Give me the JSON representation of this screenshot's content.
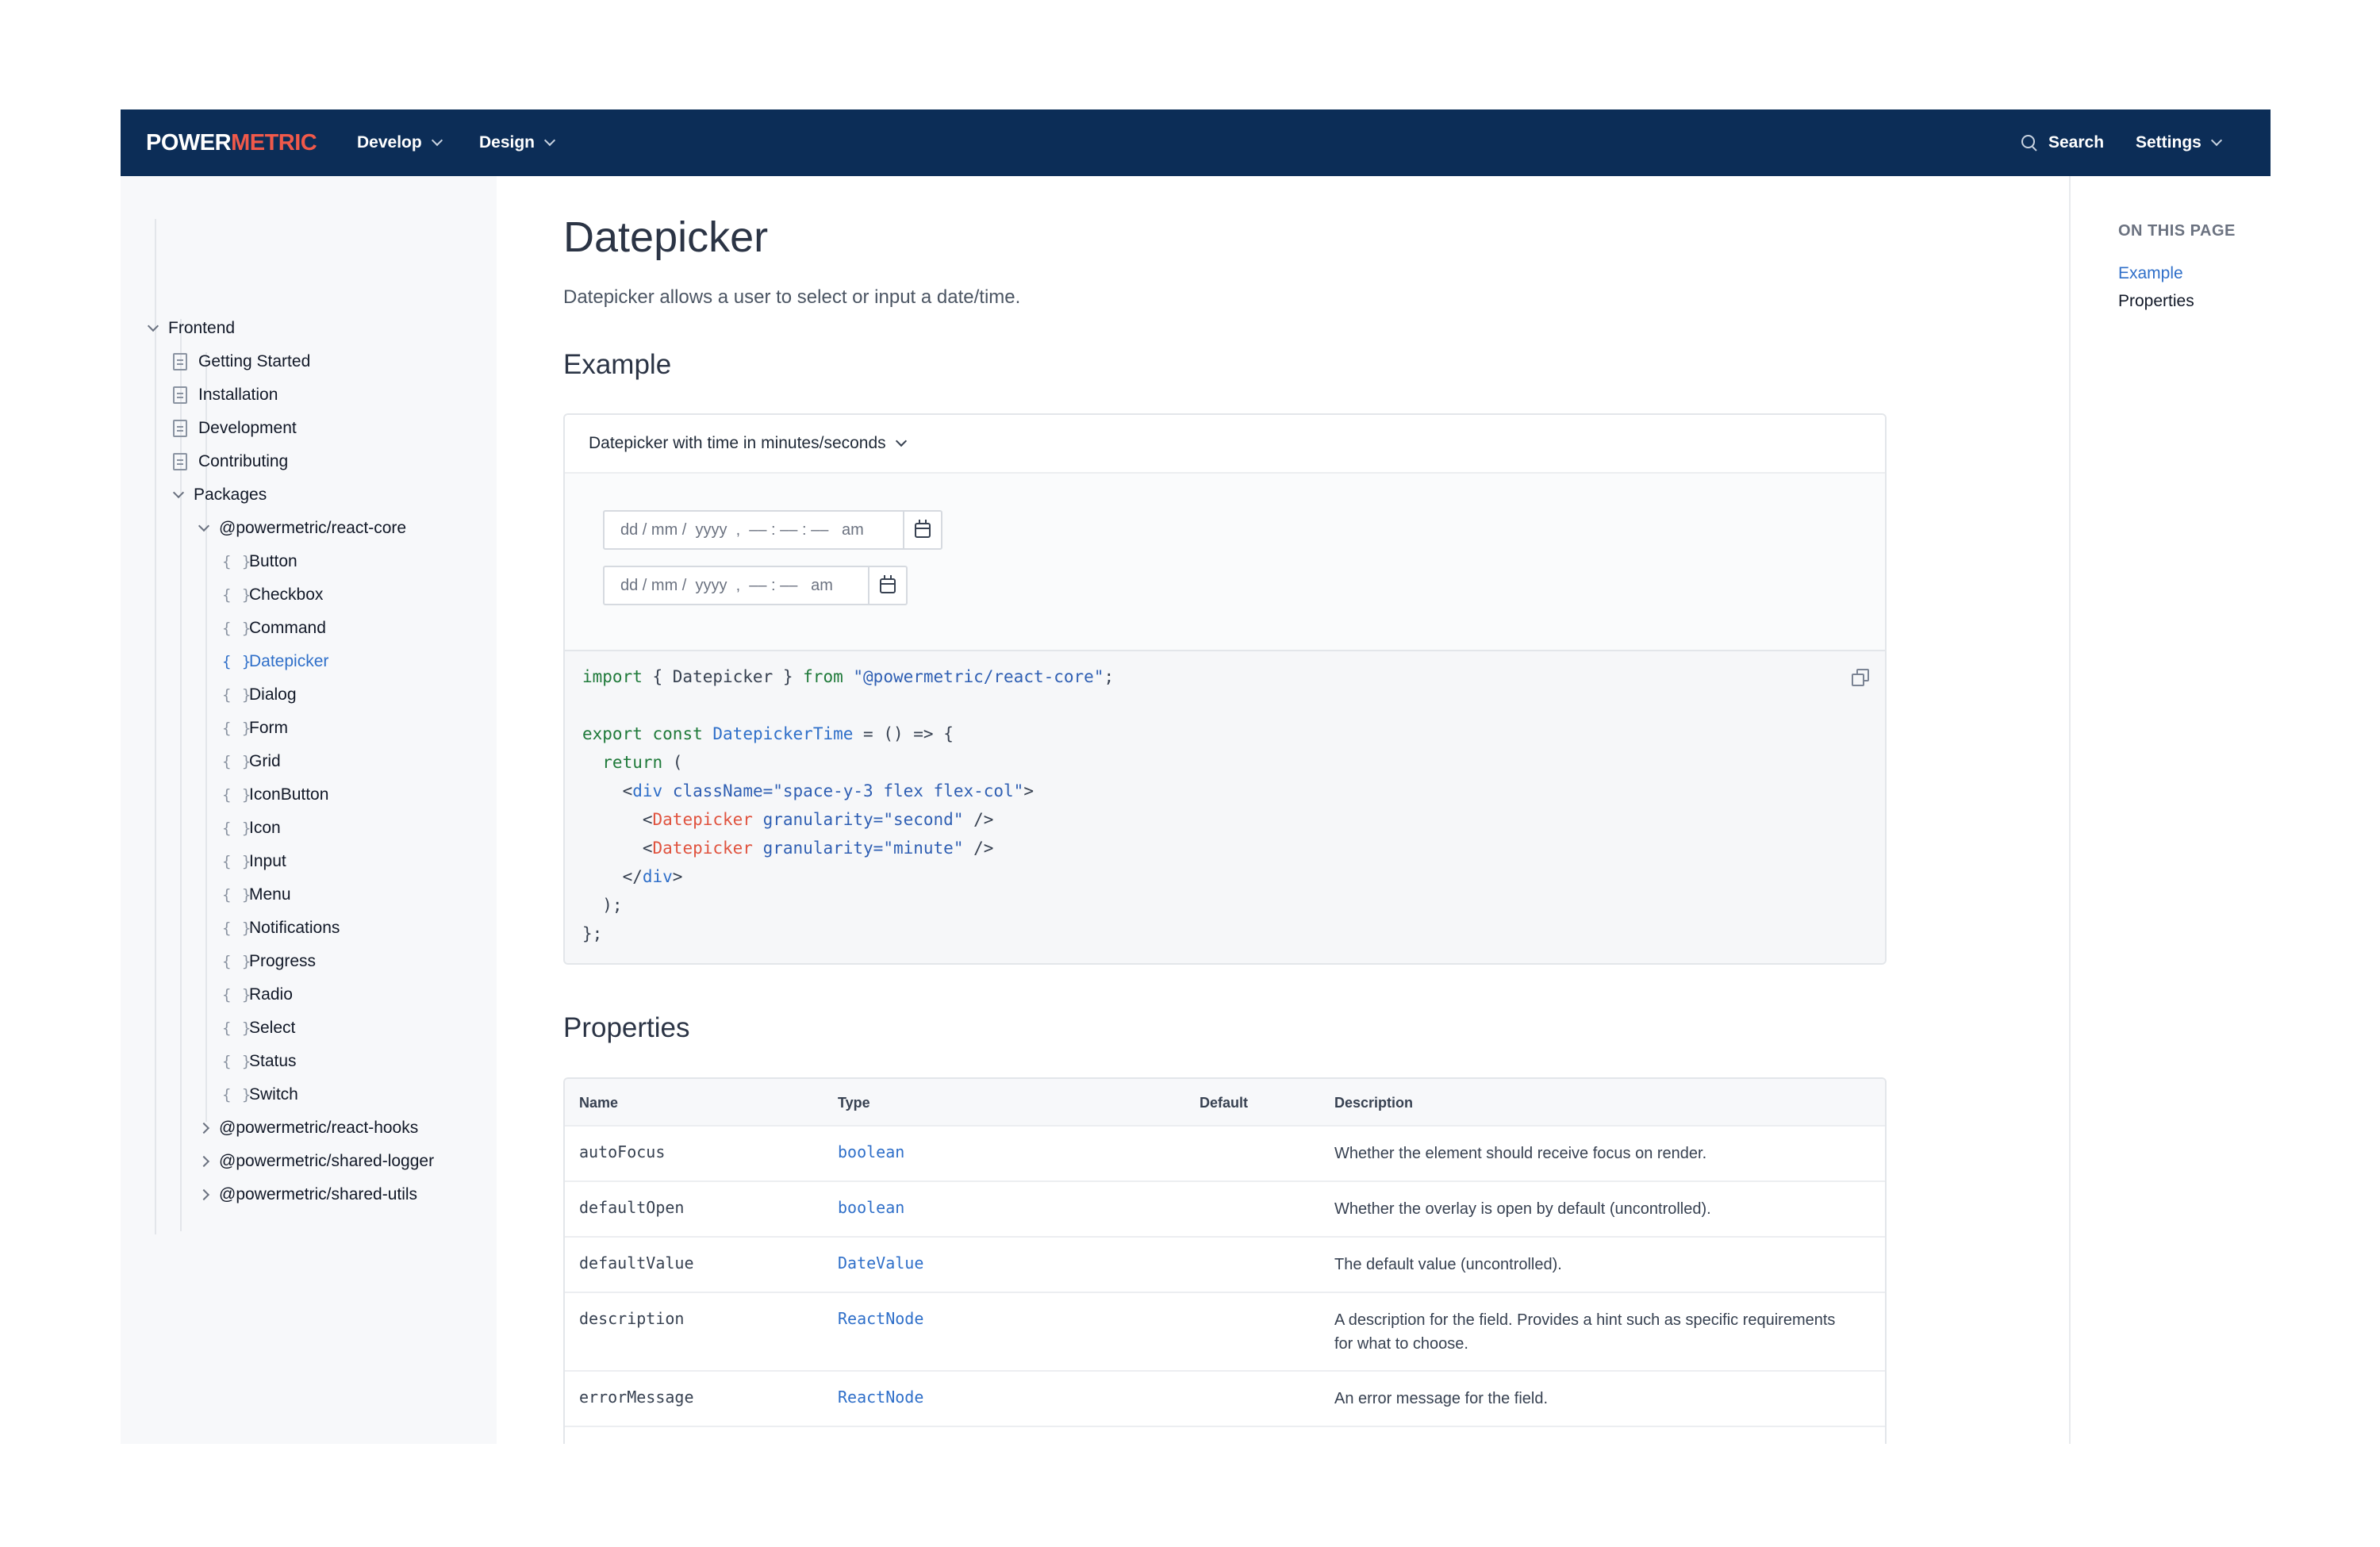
{
  "brand": {
    "logo_part1": "POWER",
    "logo_part2": "METRIC",
    "accent": "#f0594a",
    "nav_bg": "#0c2d57"
  },
  "topnav": {
    "develop": "Develop",
    "design": "Design",
    "search": "Search",
    "settings": "Settings"
  },
  "sidebar": {
    "root": "Frontend",
    "docs": [
      "Getting Started",
      "Installation",
      "Development",
      "Contributing"
    ],
    "packages": "Packages",
    "react_core": "@powermetric/react-core",
    "components": [
      "Button",
      "Checkbox",
      "Command",
      "Datepicker",
      "Dialog",
      "Form",
      "Grid",
      "IconButton",
      "Icon",
      "Input",
      "Menu",
      "Notifications",
      "Progress",
      "Radio",
      "Select",
      "Status",
      "Switch"
    ],
    "active_component": "Datepicker",
    "brace": "{ }",
    "other_packages": [
      "@powermetric/react-hooks",
      "@powermetric/shared-logger",
      "@powermetric/shared-utils"
    ]
  },
  "page": {
    "title": "Datepicker",
    "description": "Datepicker allows a user to select or input a date/time.",
    "example_heading": "Example",
    "properties_heading": "Properties"
  },
  "example": {
    "selector_label": "Datepicker with time in minutes/seconds",
    "input_seconds": "dd / mm /  yyyy  ,  ‒‒ : ‒‒ : ‒‒   am",
    "input_minutes": "dd / mm /  yyyy  ,  ‒‒ : ‒‒   am"
  },
  "code": {
    "l1": {
      "kw1": "import",
      "mid": " { Datepicker } ",
      "kw2": "from",
      "sp": " ",
      "str": "\"@powermetric/react-core\"",
      "end": ";"
    },
    "l3": {
      "kw1": "export",
      "sp1": " ",
      "kw2": "const",
      "sp2": " ",
      "fn": "DatepickerTime",
      "rest": " = () => {"
    },
    "l4": {
      "kw": "  return",
      "rest": " ("
    },
    "l5": {
      "open": "    <",
      "tag": "div",
      "sp": " ",
      "attr": "className=",
      "val": "\"space-y-3 flex flex-col\"",
      "close": ">"
    },
    "l6": {
      "open": "      <",
      "tag": "Datepicker",
      "sp": " ",
      "attr": "granularity=",
      "val": "\"second\"",
      "close": " />"
    },
    "l7": {
      "open": "      <",
      "tag": "Datepicker",
      "sp": " ",
      "attr": "granularity=",
      "val": "\"minute\"",
      "close": " />"
    },
    "l8": {
      "open": "    </",
      "tag": "div",
      "close": ">"
    },
    "l9": "  );",
    "l10": "};"
  },
  "table": {
    "headers": {
      "name": "Name",
      "type": "Type",
      "default": "Default",
      "description": "Description"
    },
    "rows": [
      {
        "name": "autoFocus",
        "type": "boolean",
        "default": "",
        "description": "Whether the element should receive focus on render."
      },
      {
        "name": "defaultOpen",
        "type": "boolean",
        "default": "",
        "description": "Whether the overlay is open by default (uncontrolled)."
      },
      {
        "name": "defaultValue",
        "type": "DateValue",
        "default": "",
        "description": "The default value (uncontrolled)."
      },
      {
        "name": "description",
        "type": "ReactNode",
        "default": "",
        "description": "A description for the field. Provides a hint such as specific requirements for what to choose."
      },
      {
        "name": "errorMessage",
        "type": "ReactNode",
        "default": "",
        "description": "An error message for the field."
      }
    ]
  },
  "toc": {
    "title": "ON THIS PAGE",
    "items": [
      "Example",
      "Properties"
    ],
    "active": "Example"
  }
}
